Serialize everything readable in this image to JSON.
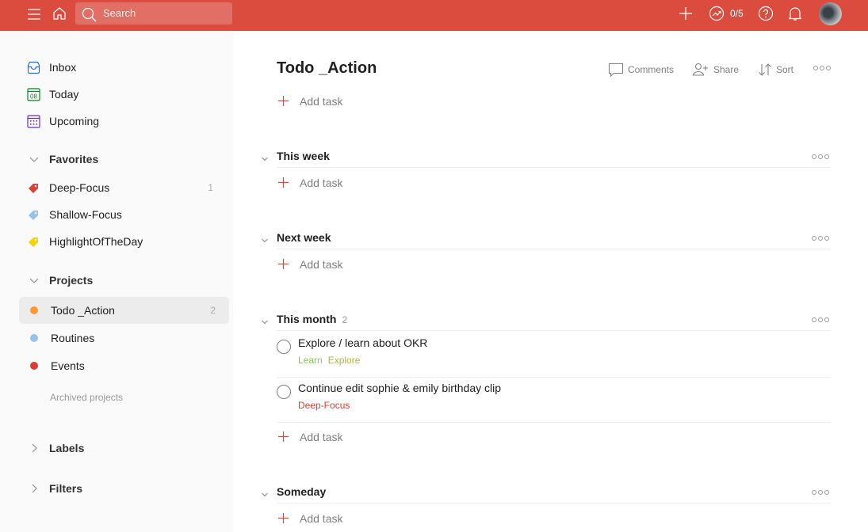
{
  "topbar": {
    "search_placeholder": "Search",
    "karma": "0/5",
    "icons": [
      "menu-icon",
      "home-icon",
      "search-icon",
      "plus-icon",
      "productivity-icon",
      "help-icon",
      "bell-icon",
      "avatar"
    ],
    "brand_color": "#db4c3f"
  },
  "sidebar": {
    "nav": [
      {
        "label": "Inbox",
        "icon": "inbox-icon",
        "color": "#246fe0"
      },
      {
        "label": "Today",
        "icon": "calendar-today-icon",
        "day": "08",
        "color": "#058527"
      },
      {
        "label": "Upcoming",
        "icon": "calendar-upcoming-icon",
        "color": "#692fc2"
      }
    ],
    "favorites": {
      "title": "Favorites",
      "items": [
        {
          "label": "Deep-Focus",
          "count": "1",
          "color": "#db4035"
        },
        {
          "label": "Shallow-Focus",
          "count": "",
          "color": "#96c3eb"
        },
        {
          "label": "HighlightOfTheDay",
          "count": "",
          "color": "#fad000"
        }
      ]
    },
    "projects": {
      "title": "Projects",
      "items": [
        {
          "label": "Todo _Action",
          "count": "2",
          "color": "#ff9933",
          "active": true
        },
        {
          "label": "Routines",
          "count": "",
          "color": "#96c3eb"
        },
        {
          "label": "Events",
          "count": "",
          "color": "#db4035"
        }
      ],
      "archived": "Archived projects"
    },
    "labels": {
      "title": "Labels"
    },
    "filters": {
      "title": "Filters"
    }
  },
  "main": {
    "title": "Todo _Action",
    "actions": {
      "comments": "Comments",
      "share": "Share",
      "sort": "Sort"
    },
    "add_task": "Add task",
    "sections": [
      {
        "name": "This week",
        "count": "",
        "tasks": []
      },
      {
        "name": "Next week",
        "count": "",
        "tasks": []
      },
      {
        "name": "This month",
        "count": "2",
        "tasks": [
          {
            "name": "Explore / learn about OKR",
            "labels": [
              {
                "text": "Learn",
                "color": "#7ecc49"
              },
              {
                "text": "Explore",
                "color": "#afb83b"
              }
            ]
          },
          {
            "name": "Continue edit sophie & emily birthday clip",
            "labels": [
              {
                "text": "Deep-Focus",
                "color": "#db4035"
              }
            ]
          }
        ]
      },
      {
        "name": "Someday",
        "count": "",
        "tasks": []
      }
    ]
  }
}
